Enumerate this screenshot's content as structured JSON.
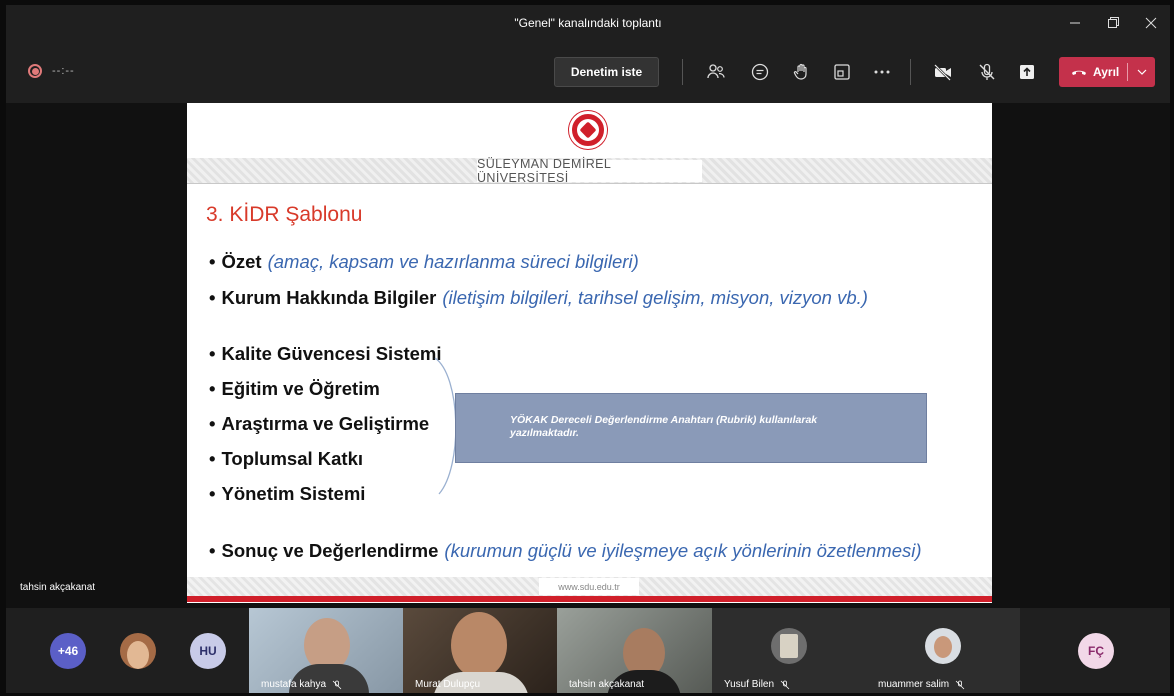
{
  "window": {
    "title": "\"Genel\" kanalındaki toplantı",
    "controls": [
      "minimize-icon",
      "maximize-icon",
      "close-icon"
    ]
  },
  "toolbar": {
    "recording_time": "--:--",
    "request_control_label": "Denetim iste",
    "icons": [
      "participants-icon",
      "chat-icon",
      "raise-hand-icon",
      "rooms-icon",
      "more-icon",
      "camera-off-icon",
      "mic-off-icon",
      "share-icon"
    ],
    "leave_label": "Ayrıl",
    "leave_color": "#c4314b"
  },
  "slide": {
    "university": "SÜLEYMAN DEMİREL ÜNİVERSİTESİ",
    "title": "3. KİDR Şablonu",
    "title_color": "#d83a2a",
    "bullets": [
      {
        "text": "Özet",
        "note": "(amaç, kapsam ve hazırlanma süreci bilgileri)"
      },
      {
        "text": "Kurum Hakkında Bilgiler",
        "note": "(iletişim bilgileri, tarihsel gelişim, misyon, vizyon vb.)"
      },
      {
        "text": "Kalite Güvencesi Sistemi",
        "note": ""
      },
      {
        "text": "Eğitim ve Öğretim",
        "note": ""
      },
      {
        "text": "Araştırma ve Geliştirme",
        "note": ""
      },
      {
        "text": "Toplumsal Katkı",
        "note": ""
      },
      {
        "text": "Yönetim Sistemi",
        "note": ""
      },
      {
        "text": "Sonuç ve Değerlendirme",
        "note": "(kurumun güçlü ve iyileşmeye açık yönlerinin özetlenmesi)"
      }
    ],
    "callout": "YÖKAK Dereceli Değerlendirme Anahtarı (Rubrik) kullanılarak yazılmaktadır.",
    "footer_url": "www.sdu.edu.tr"
  },
  "presenter": "tahsin akçakanat",
  "participants": {
    "overflow_count": "+46",
    "initials_1": "HU",
    "initials_2": "FÇ",
    "tiles": [
      {
        "name": "mustafa kahya"
      },
      {
        "name": "Murat Dulupçu"
      },
      {
        "name": "tahsin akçakanat"
      },
      {
        "name": "Yusuf Bilen"
      },
      {
        "name": "muammer salim"
      }
    ]
  }
}
